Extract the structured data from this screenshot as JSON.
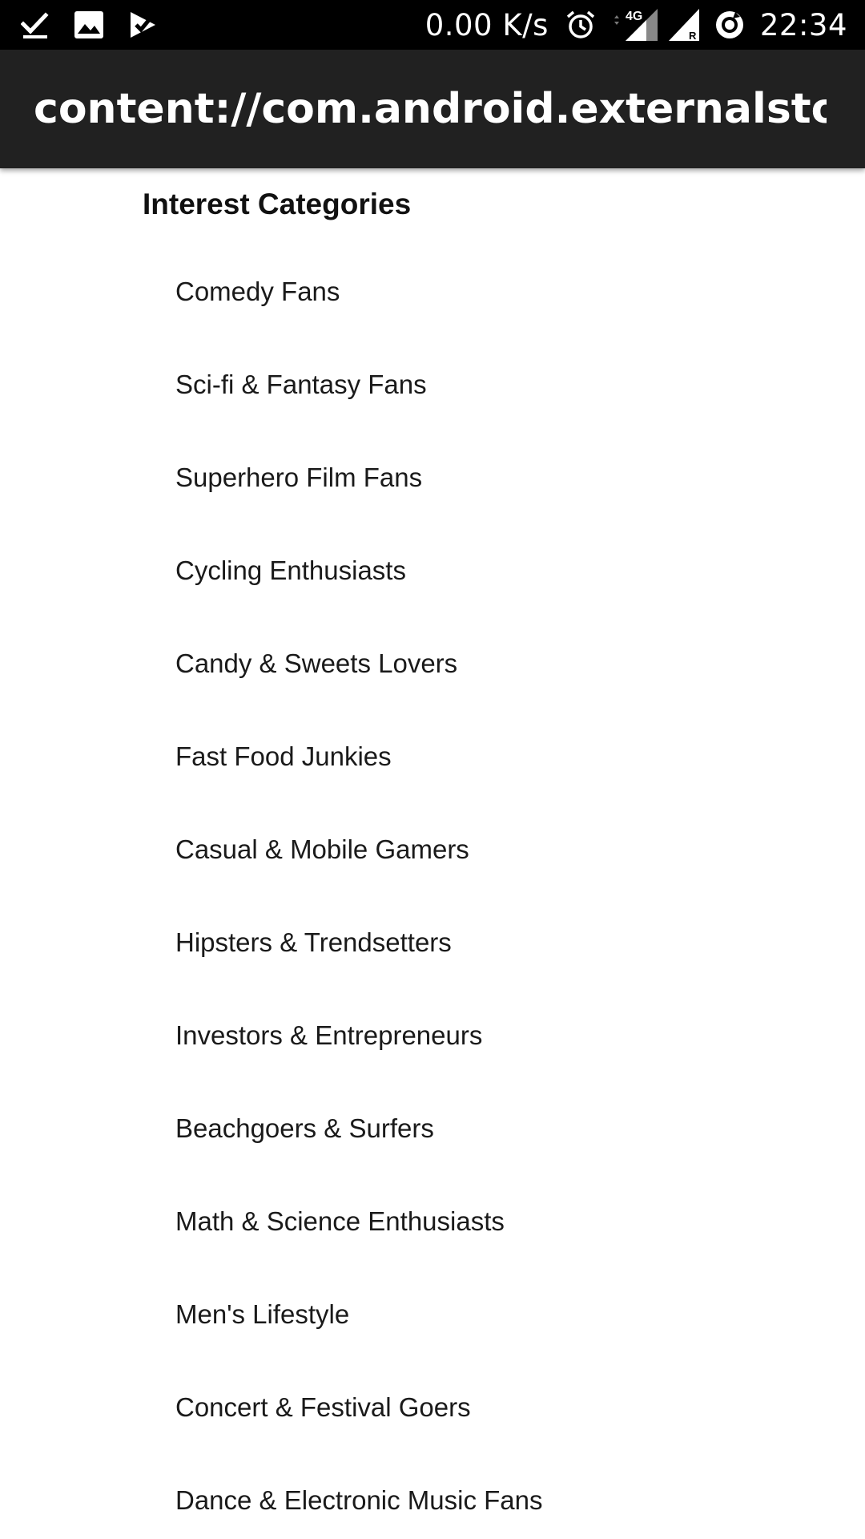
{
  "status_bar": {
    "net_speed": "0.00 K/s",
    "network_type": "4G",
    "roaming": "R",
    "time": "22:34",
    "icons": [
      "download-done-icon",
      "image-icon",
      "task-done-icon",
      "alarm-icon",
      "lte-signal-icon",
      "signal-roaming-icon",
      "sync-icon"
    ]
  },
  "app_bar": {
    "title": "content://com.android.externalstor..."
  },
  "content": {
    "heading": "Interest Categories",
    "categories": [
      "Comedy Fans",
      "Sci-fi & Fantasy Fans",
      "Superhero Film Fans",
      "Cycling Enthusiasts",
      "Candy & Sweets Lovers",
      "Fast Food Junkies",
      "Casual & Mobile Gamers",
      "Hipsters & Trendsetters",
      "Investors & Entrepreneurs",
      "Beachgoers & Surfers",
      "Math & Science Enthusiasts",
      "Men's Lifestyle",
      "Concert & Festival Goers",
      "Dance & Electronic Music Fans"
    ]
  },
  "colors": {
    "status_bar_bg": "#000000",
    "app_bar_bg": "#212121",
    "page_bg": "#ffffff",
    "text": "#1a1a1a"
  }
}
